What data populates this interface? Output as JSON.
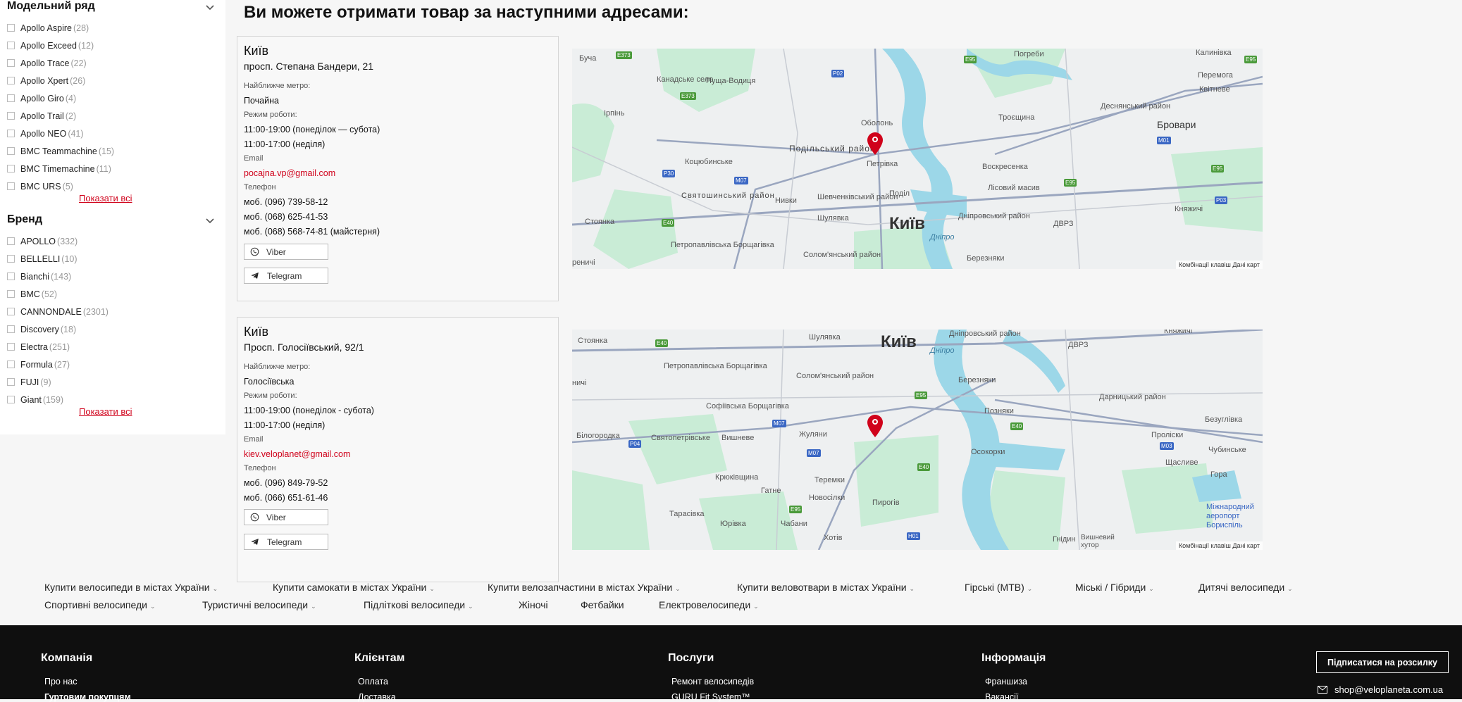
{
  "sidebar": {
    "model_title": "Модельний ряд",
    "models": [
      {
        "name": "Apollo Aspire",
        "count": "(28)"
      },
      {
        "name": "Apollo Exceed",
        "count": "(12)"
      },
      {
        "name": "Apollo Trace",
        "count": "(22)"
      },
      {
        "name": "Apollo Xpert",
        "count": "(26)"
      },
      {
        "name": "Apollo Giro",
        "count": "(4)"
      },
      {
        "name": "Apollo Trail",
        "count": "(2)"
      },
      {
        "name": "Apollo NEO",
        "count": "(41)"
      },
      {
        "name": "BMC Teammachine",
        "count": "(15)"
      },
      {
        "name": "BMC Timemachine",
        "count": "(11)"
      },
      {
        "name": "BMC URS",
        "count": "(5)"
      }
    ],
    "show_all_1": "Показати всі",
    "brand_title": "Бренд",
    "brands": [
      {
        "name": "APOLLO",
        "count": "(332)"
      },
      {
        "name": "BELLELLI",
        "count": "(10)"
      },
      {
        "name": "Bianchi",
        "count": "(143)"
      },
      {
        "name": "BMC",
        "count": "(52)"
      },
      {
        "name": "CANNONDALE",
        "count": "(2301)"
      },
      {
        "name": "Discovery",
        "count": "(18)"
      },
      {
        "name": "Electra",
        "count": "(251)"
      },
      {
        "name": "Formula",
        "count": "(27)"
      },
      {
        "name": "FUJI",
        "count": "(9)"
      },
      {
        "name": "Giant",
        "count": "(159)"
      }
    ],
    "show_all_2": "Показати всі"
  },
  "main": {
    "title": "Ви можете отримати товар за наступними адресами:",
    "stores": [
      {
        "city": "Київ",
        "address": "просп. Степана Бандери, 21",
        "metro_label": "Найближче метро:",
        "metro": "Почайна",
        "hours_label": "Режим роботи:",
        "hours_1": "11:00-19:00 (понеділок — субота)",
        "hours_2": "11:00-17:00 (неділя)",
        "email_label": "Email",
        "email": "pocajna.vp@gmail.com",
        "phone_label": "Телефон",
        "phones": [
          "моб. (096) 739-58-12",
          "моб. (068) 625-41-53",
          "моб. (068) 568-74-81 (майстерня)"
        ],
        "viber": "Viber",
        "telegram": "Telegram"
      },
      {
        "city": "Київ",
        "address": "Просп. Голосіївський, 92/1",
        "metro_label": "Найближче метро:",
        "metro": "Голосіївська",
        "hours_label": "Режим роботи:",
        "hours_1": "11:00-19:00 (понеділок - субота)",
        "hours_2": "11:00-17:00 (неділя)",
        "email_label": "Email",
        "email": "kiev.veloplanet@gmail.com",
        "phone_label": "Телефон",
        "phones": [
          "моб. (096) 849-79-52",
          "моб. (066) 651-61-46"
        ],
        "viber": "Viber",
        "telegram": "Telegram"
      }
    ],
    "map1": {
      "city": "Київ",
      "places": [
        "Буча",
        "Пуща-Водиця",
        "Канадське село",
        "Ірпінь",
        "Оболонь",
        "Погреби",
        "Калинівка",
        "Перемога",
        "Квітневе",
        "Деснянський район",
        "Троєщина",
        "Бровари",
        "Коцюбинське",
        "Петрівка",
        "Воскресенка",
        "Святошинський район",
        "Нивки",
        "Шевченківський район",
        "Поділ",
        "Лісовий масив",
        "Стоянка",
        "Шулявка",
        "Дніпровський район",
        "Княжичі",
        "ДВРЗ",
        "Петропавлівська Борщагівка",
        "Солом'янський район",
        "Березняки",
        "реничі",
        "Дніпро"
      ],
      "district": "Подільський район",
      "footer": "Комбінації клавіш   Дані карт"
    },
    "map2": {
      "city": "Київ",
      "places": [
        "Стоянка",
        "Шулявка",
        "Дніпровський район",
        "ДВРЗ",
        "Княжичі",
        "Петропавлівська Борщагівка",
        "Солом'янський район",
        "Березняки",
        "ничі",
        "Софіївська Борщагівка",
        "Позняки",
        "Дарницький район",
        "Безуглівка",
        "Білогородка",
        "Святопетрівське",
        "Вишневе",
        "Жуляни",
        "Пролiски",
        "Чубинське",
        "Крюківщина",
        "Теремки",
        "Осокорки",
        "Щасливе",
        "Гатне",
        "Новосілки",
        "Пирогів",
        "Гора",
        "Тарасівка",
        "Юрівка",
        "Чабани",
        "Хотів",
        "Гнідин",
        "Вишневий хутор",
        "Міжнародний аеропорт Бориспіль",
        "Дніпро"
      ],
      "footer": "Комбінації клавіш   Дані карт"
    }
  },
  "links_row1": [
    "Купити велосипеди в містах України",
    "Купити самокати в містах України",
    "Купити велозапчастини в містах України",
    "Купити веловотвари в містах України",
    "Гірські (MTB)",
    "Міські / Гібриди",
    "Дитячі велосипеди"
  ],
  "links_row2": [
    "Спортивні велосипеди",
    "Туристичні велосипеди",
    "Підліткові велосипеди",
    "Жіночі",
    "Фетбайки",
    "Електровелосипеди"
  ],
  "footer": {
    "col1_title": "Компанія",
    "col1_links": [
      "Про нас",
      "Гуртовим покупцям"
    ],
    "col2_title": "Клієнтам",
    "col2_links": [
      "Оплата",
      "Доставка"
    ],
    "col3_title": "Послуги",
    "col3_links": [
      "Ремонт велосипедів",
      "GURU Fit System™"
    ],
    "col4_title": "Інформація",
    "col4_links": [
      "Франшиза",
      "Вакансії"
    ],
    "subscribe": "Підписатися на розсилку",
    "email": "shop@veloplaneta.com.ua"
  },
  "colors": {
    "accent": "#d0021b",
    "footer_bg": "#0f0f0f",
    "map_water": "#9cd7e8",
    "map_park": "#c9ecd6"
  }
}
